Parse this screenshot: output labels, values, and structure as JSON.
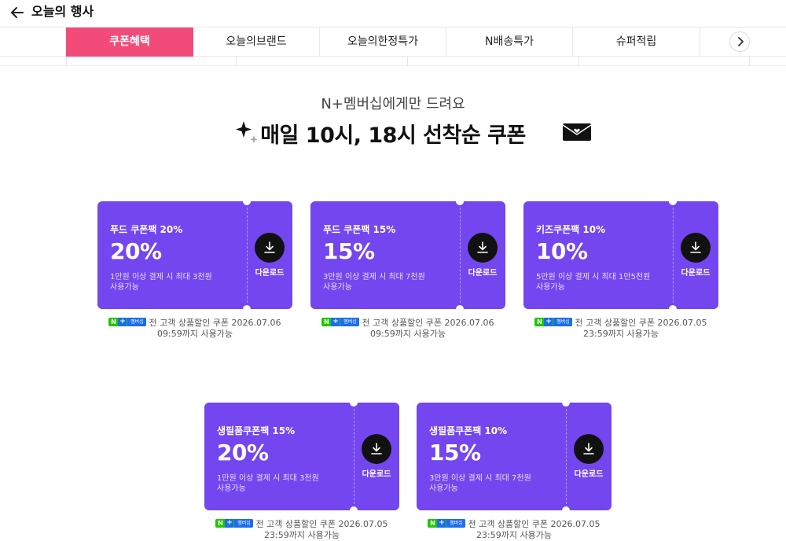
{
  "header": {
    "title": "오늘의 행사",
    "back_icon": "arrow-left-icon"
  },
  "tabs": [
    {
      "label": "쿠폰혜택",
      "active": true
    },
    {
      "label": "오늘의브랜드",
      "active": false
    },
    {
      "label": "오늘의한정특가",
      "active": false
    },
    {
      "label": "N배송특가",
      "active": false
    },
    {
      "label": "슈퍼적립",
      "active": false
    }
  ],
  "promo": {
    "sub_headline": "N+멤버십에게만 드려요",
    "headline": "매일 10시, 18시 선착순 쿠폰"
  },
  "coupons": [
    {
      "name": "푸드 쿠폰팩 20%",
      "rate": "20%",
      "condition_line1": "1만원 이상 결제 시 최대 3천원",
      "condition_line2": "사용가능",
      "download_label": "다운로드",
      "badge_n": "N",
      "badge_plus": "+",
      "badge_text": "멤버십",
      "note_line1": "전 고객 상품할인 쿠폰 2026.07.06",
      "note_line2": "09:59까지 사용가능"
    },
    {
      "name": "푸드 쿠폰팩 15%",
      "rate": "15%",
      "condition_line1": "3만원 이상 결제 시 최대 7천원",
      "condition_line2": "사용가능",
      "download_label": "다운로드",
      "badge_n": "N",
      "badge_plus": "+",
      "badge_text": "멤버십",
      "note_line1": "전 고객 상품할인 쿠폰 2026.07.06",
      "note_line2": "09:59까지 사용가능"
    },
    {
      "name": "키즈쿠폰팩 10%",
      "rate": "10%",
      "condition_line1": "5만원 이상 결제 시 최대 1만5천원",
      "condition_line2": "사용가능",
      "download_label": "다운로드",
      "badge_n": "N",
      "badge_plus": "+",
      "badge_text": "멤버십",
      "note_line1": "전 고객 상품할인 쿠폰 2026.07.05",
      "note_line2": "23:59까지 사용가능"
    },
    {
      "name": "생필품쿠폰팩 15%",
      "rate": "20%",
      "condition_line1": "1만원 이상 결제 시 최대 3천원",
      "condition_line2": "사용가능",
      "download_label": "다운로드",
      "badge_n": "N",
      "badge_plus": "+",
      "badge_text": "멤버십",
      "note_line1": "전 고객 상품할인 쿠폰 2026.07.05",
      "note_line2": "23:59까지 사용가능"
    },
    {
      "name": "생필품쿠폰팩 10%",
      "rate": "15%",
      "condition_line1": "3만원 이상 결제 시 최대 7천원",
      "condition_line2": "사용가능",
      "download_label": "다운로드",
      "badge_n": "N",
      "badge_plus": "+",
      "badge_text": "멤버십",
      "note_line1": "전 고객 상품할인 쿠폰 2026.07.05",
      "note_line2": "23:59까지 사용가능"
    }
  ],
  "colors": {
    "active_tab": "#f24b7a",
    "coupon": "#7446ef",
    "membership_green": "#1ec800",
    "membership_blue": "#1c6cf0"
  }
}
